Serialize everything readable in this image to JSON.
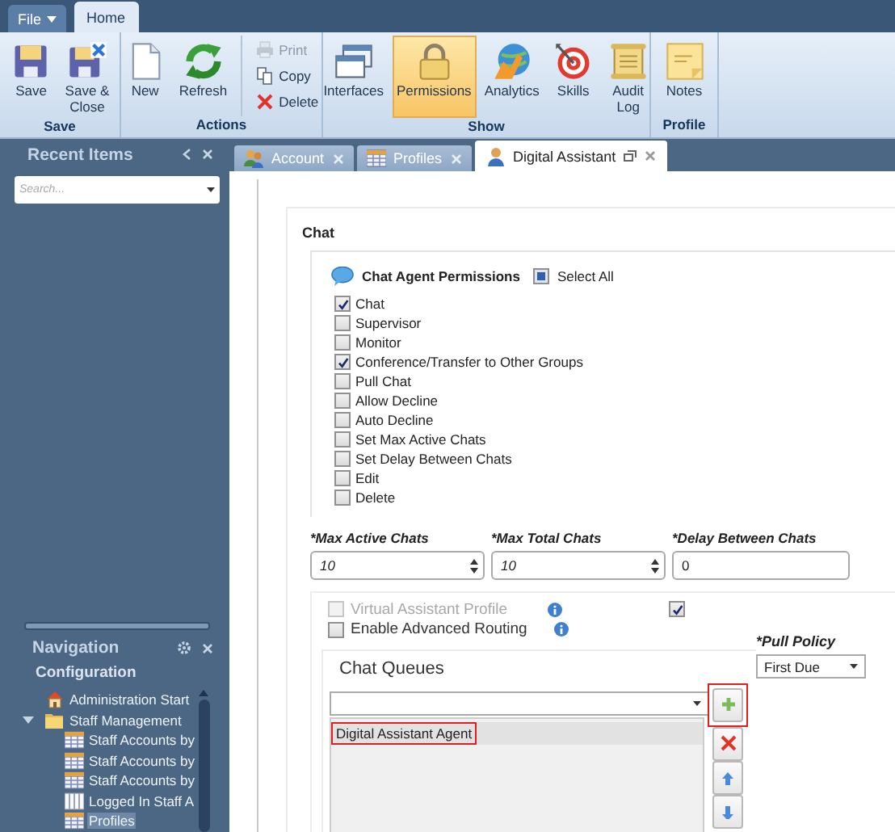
{
  "app_tabs": [
    {
      "label": "File",
      "kind": "menu",
      "selected": false
    },
    {
      "label": "Home",
      "kind": "tab",
      "selected": true
    }
  ],
  "ribbon": {
    "groups": [
      {
        "label": "Save",
        "buttons": [
          {
            "label": "Save",
            "kind": "large",
            "selected": false,
            "disabled": false
          },
          {
            "label": "Save &\nClose",
            "kind": "large",
            "selected": false,
            "disabled": false
          }
        ]
      },
      {
        "label": "Actions",
        "buttons": [
          {
            "label": "New",
            "kind": "large",
            "selected": false,
            "disabled": false
          },
          {
            "label": "Refresh",
            "kind": "large",
            "selected": false,
            "disabled": false
          },
          {
            "label": "Print",
            "kind": "small",
            "selected": false,
            "disabled": true
          },
          {
            "label": "Copy",
            "kind": "small",
            "selected": false,
            "disabled": false
          },
          {
            "label": "Delete",
            "kind": "small",
            "selected": false,
            "disabled": false
          }
        ]
      },
      {
        "label": "Show",
        "buttons": [
          {
            "label": "Interfaces",
            "kind": "large",
            "selected": false,
            "disabled": false
          },
          {
            "label": "Permissions",
            "kind": "large",
            "selected": true,
            "disabled": false
          },
          {
            "label": "Analytics",
            "kind": "large",
            "selected": false,
            "disabled": false
          },
          {
            "label": "Skills",
            "kind": "large",
            "selected": false,
            "disabled": false
          },
          {
            "label": "Audit\nLog",
            "kind": "large",
            "selected": false,
            "disabled": false
          }
        ]
      },
      {
        "label": "Profile",
        "buttons": [
          {
            "label": "Notes",
            "kind": "large",
            "selected": false,
            "disabled": false
          }
        ]
      }
    ]
  },
  "recent_items": {
    "title": "Recent Items",
    "search": {
      "placeholder": "Search..."
    }
  },
  "navigation": {
    "title": "Navigation",
    "section": "Configuration",
    "tree": [
      {
        "label": "Administration Start",
        "kind": "start",
        "selected": false
      },
      {
        "label": "Staff Management",
        "kind": "folder",
        "selected": false,
        "expanded": true,
        "children": [
          {
            "label": "Staff Accounts by",
            "kind": "report",
            "selected": false
          },
          {
            "label": "Staff Accounts by",
            "kind": "report",
            "selected": false
          },
          {
            "label": "Staff Accounts by",
            "kind": "report",
            "selected": false
          },
          {
            "label": "Logged In Staff A",
            "kind": "list",
            "selected": false
          },
          {
            "label": "Profiles",
            "kind": "report",
            "selected": true
          }
        ]
      }
    ]
  },
  "doc_tabs": [
    {
      "label": "Account",
      "selected": false
    },
    {
      "label": "Profiles",
      "selected": false
    },
    {
      "label": "Digital Assistant",
      "selected": true
    }
  ],
  "form": {
    "section_title": "Chat",
    "permissions": {
      "title": "Chat Agent Permissions",
      "select_all": {
        "label": "Select All",
        "checked": false,
        "indeterminate": true
      },
      "items": [
        {
          "label": "Chat",
          "checked": true
        },
        {
          "label": "Supervisor",
          "checked": false
        },
        {
          "label": "Monitor",
          "checked": false
        },
        {
          "label": "Conference/Transfer to Other Groups",
          "checked": true
        },
        {
          "label": "Pull Chat",
          "checked": false
        },
        {
          "label": "Allow Decline",
          "checked": false
        },
        {
          "label": "Auto Decline",
          "checked": false
        },
        {
          "label": "Set Max Active Chats",
          "checked": false
        },
        {
          "label": "Set Delay Between Chats",
          "checked": false
        },
        {
          "label": "Edit",
          "checked": false
        },
        {
          "label": "Delete",
          "checked": false
        }
      ]
    },
    "fields": [
      {
        "label": "*Max Active Chats",
        "kind": "spinner",
        "value": "10"
      },
      {
        "label": "*Max Total Chats",
        "kind": "spinner",
        "value": "10"
      },
      {
        "label": "*Delay Between Chats",
        "kind": "text",
        "value": "0"
      }
    ],
    "options": [
      {
        "label": "Virtual Assistant Profile",
        "checked": false,
        "disabled": true
      },
      {
        "label": "Enable Advanced Routing",
        "checked": false,
        "disabled": false
      }
    ],
    "flag_checkbox": {
      "checked": true
    },
    "pull_policy": {
      "label": "*Pull Policy",
      "value": "First Due"
    },
    "chat_queues": {
      "title": "Chat Queues",
      "items": [
        {
          "label": "Digital Assistant Agent",
          "selected": true,
          "highlighted": true
        }
      ],
      "buttons": [
        {
          "kind": "add",
          "highlighted": true
        },
        {
          "kind": "remove",
          "highlighted": false
        },
        {
          "kind": "up",
          "highlighted": false
        },
        {
          "kind": "down",
          "highlighted": false
        }
      ]
    }
  }
}
